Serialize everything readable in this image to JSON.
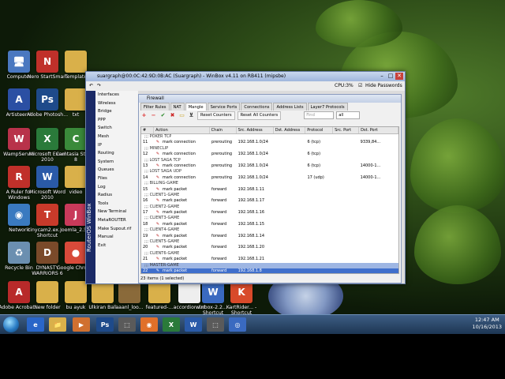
{
  "desktop_icons": [
    {
      "label": "Computer",
      "color": "#4a78c0",
      "glyph": "🖥"
    },
    {
      "label": "Nero StartSmart",
      "color": "#c0302a",
      "glyph": "N"
    },
    {
      "label": "Template",
      "color": "#d9b04a",
      "glyph": ""
    },
    {
      "label": "Artisteer 4",
      "color": "#2b4fa3",
      "glyph": "A"
    },
    {
      "label": "Adobe Photosh...",
      "color": "#1e4a8a",
      "glyph": "Ps"
    },
    {
      "label": "txt",
      "color": "#d9b04a",
      "glyph": ""
    },
    {
      "label": "WampServer",
      "color": "#b8324a",
      "glyph": "W"
    },
    {
      "label": "Microsoft Excel 2010",
      "color": "#2a7a3a",
      "glyph": "X"
    },
    {
      "label": "Camtasia Studio 8",
      "color": "#3a8a3a",
      "glyph": "C"
    },
    {
      "label": "A Ruler for Windows",
      "color": "#c0302a",
      "glyph": "R"
    },
    {
      "label": "Microsoft Word 2010",
      "color": "#2a5aa8",
      "glyph": "W"
    },
    {
      "label": "video",
      "color": "#d9b04a",
      "glyph": ""
    },
    {
      "label": "Network",
      "color": "#3a7ac0",
      "glyph": "◉"
    },
    {
      "label": "tinycam2.ex... - Shortcut",
      "color": "#c83a2a",
      "glyph": "T"
    },
    {
      "label": "Joomla_2.5...",
      "color": "#c83a5a",
      "glyph": "J"
    },
    {
      "label": "Recycle Bin",
      "color": "#6b8fb0",
      "glyph": "♻"
    },
    {
      "label": "DYNASTY WARRIORS 6",
      "color": "#7a4a2a",
      "glyph": "D"
    },
    {
      "label": "Google Chrome",
      "color": "#d84a3a",
      "glyph": "●"
    },
    {
      "label": "Adobe Acrobat...",
      "color": "#b82a2a",
      "glyph": "A"
    },
    {
      "label": "New folder",
      "color": "#d9b04a",
      "glyph": ""
    },
    {
      "label": "bu ayuk",
      "color": "#d9b04a",
      "glyph": ""
    },
    {
      "label": "Ulkiran Bali",
      "color": "#d9b04a",
      "glyph": ""
    },
    {
      "label": "aaanl_loo...",
      "color": "#8a6a3a",
      "glyph": ""
    },
    {
      "label": "featured-...",
      "color": "#d9b04a",
      "glyph": ""
    },
    {
      "label": "accordion.txt",
      "color": "#eeeeee",
      "glyph": ""
    },
    {
      "label": "winbox-2.2... - Shortcut",
      "color": "#3a6ac0",
      "glyph": "W"
    },
    {
      "label": "KartRider... - Shortcut",
      "color": "#d84a2a",
      "glyph": "K"
    }
  ],
  "winbox": {
    "title": "suargraph@00:0C:42:9D:0B:AC (Suargraph) - WinBox v4.11 on RB411 (mipsbe)",
    "cpu": "CPU:3%",
    "hide_passwords": "Hide Passwords",
    "side_label": "RouterOS WinBox",
    "menu": [
      "Interfaces",
      "Wireless",
      "Bridge",
      "PPP",
      "Switch",
      "Mesh",
      "IP",
      "Routing",
      "System",
      "Queues",
      "Files",
      "Log",
      "Radius",
      "Tools",
      "New Terminal",
      "MetaROUTER",
      "Make Supout.rif",
      "Manual",
      "Exit"
    ],
    "firewall": {
      "title": "Firewall",
      "tabs": [
        "Filter Rules",
        "NAT",
        "Mangle",
        "Service Ports",
        "Connections",
        "Address Lists",
        "Layer7 Protocols"
      ],
      "active_tab": "Mangle",
      "reset_counters": "Reset Counters",
      "reset_all_counters": "Reset All Counters",
      "find_placeholder": "Find",
      "filter_value": "all",
      "columns": [
        "#",
        "Action",
        "Chain",
        "Src. Address",
        "Dst. Address",
        "Protocol",
        "Src. Port",
        "Dst. Port"
      ],
      "rows": [
        {
          "comment": ";;; POKER TCP"
        },
        {
          "num": "11",
          "action": "mark connection",
          "chain": "prerouting",
          "src": "192.168.1.0/24",
          "dst": "",
          "proto": "6 (tcp)",
          "sport": "",
          "dport": "9339,84..."
        },
        {
          "comment": ";;; MINECLIP"
        },
        {
          "num": "12",
          "action": "mark connection",
          "chain": "prerouting",
          "src": "192.168.1.0/24",
          "dst": "",
          "proto": "6 (tcp)",
          "sport": "",
          "dport": ""
        },
        {
          "comment": ";;; LOST SAGA TCP"
        },
        {
          "num": "13",
          "action": "mark connection",
          "chain": "prerouting",
          "src": "192.168.1.0/24",
          "dst": "",
          "proto": "6 (tcp)",
          "sport": "",
          "dport": "14000-1..."
        },
        {
          "comment": ";;; LOST SAGA UDP"
        },
        {
          "num": "14",
          "action": "mark connection",
          "chain": "prerouting",
          "src": "192.168.1.0/24",
          "dst": "",
          "proto": "17 (udp)",
          "sport": "",
          "dport": "14000-1..."
        },
        {
          "comment": ";;; BILLING-GAME"
        },
        {
          "num": "15",
          "action": "mark packet",
          "chain": "forward",
          "src": "192.168.1.11",
          "dst": "",
          "proto": "",
          "sport": "",
          "dport": ""
        },
        {
          "comment": ";;; CLIENT1-GAME"
        },
        {
          "num": "16",
          "action": "mark packet",
          "chain": "forward",
          "src": "192.168.1.17",
          "dst": "",
          "proto": "",
          "sport": "",
          "dport": ""
        },
        {
          "comment": ";;; CLIENT2-GAME"
        },
        {
          "num": "17",
          "action": "mark packet",
          "chain": "forward",
          "src": "192.168.1.16",
          "dst": "",
          "proto": "",
          "sport": "",
          "dport": ""
        },
        {
          "comment": ";;; CLIENT3-GAME"
        },
        {
          "num": "18",
          "action": "mark packet",
          "chain": "forward",
          "src": "192.168.1.15",
          "dst": "",
          "proto": "",
          "sport": "",
          "dport": ""
        },
        {
          "comment": ";;; CLIENT4-GAME"
        },
        {
          "num": "19",
          "action": "mark packet",
          "chain": "forward",
          "src": "192.168.1.14",
          "dst": "",
          "proto": "",
          "sport": "",
          "dport": ""
        },
        {
          "comment": ";;; CLIENT5-GAME"
        },
        {
          "num": "20",
          "action": "mark packet",
          "chain": "forward",
          "src": "192.168.1.20",
          "dst": "",
          "proto": "",
          "sport": "",
          "dport": ""
        },
        {
          "comment": ";;; CLIENT6-GAME"
        },
        {
          "num": "21",
          "action": "mark packet",
          "chain": "forward",
          "src": "192.168.1.21",
          "dst": "",
          "proto": "",
          "sport": "",
          "dport": ""
        },
        {
          "comment": ";;; MASTER-GAME",
          "selected": true
        },
        {
          "num": "22",
          "action": "mark packet",
          "chain": "forward",
          "src": "192.168.1.8",
          "dst": "",
          "proto": "",
          "sport": "",
          "dport": "",
          "selected": true
        }
      ],
      "status": "23 items (1 selected)"
    }
  },
  "taskbar": {
    "items": [
      "e",
      "📁",
      "▶",
      "Ps",
      "⬚",
      "◉",
      "X",
      "W",
      "⬚",
      "◎"
    ],
    "time": "12:47 AM",
    "date": "10/16/2013"
  }
}
